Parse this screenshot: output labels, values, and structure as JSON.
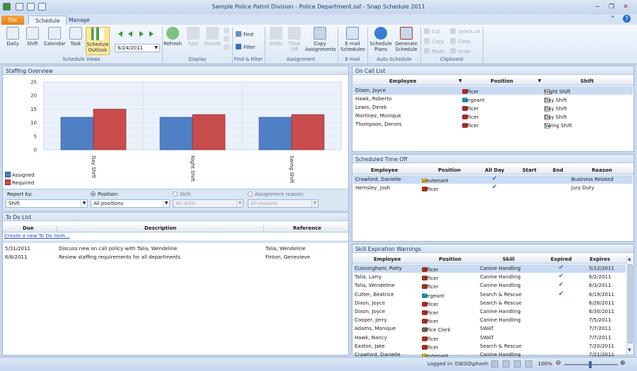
{
  "window": {
    "title": "Sample Police Patrol Division - Police Department.ssf - Snap Schedule 2011",
    "minimize": "−",
    "restore": "❐",
    "close": "✕"
  },
  "tabs": {
    "file": "File",
    "schedule": "Schedule",
    "manage": "Manage"
  },
  "ribbon": {
    "daily": "Daily",
    "shift": "Shift",
    "calendar": "Calendar",
    "task": "Task",
    "schedule_outlook": "Schedule Outlook",
    "date": "6/24/2011",
    "schedule_views": "Schedule Views",
    "refresh": "Refresh",
    "sort": "Sort",
    "details": "Details",
    "display": "Display",
    "find": "Find",
    "filter": "Filter",
    "find_filter": "Find & Filter",
    "shifts": "Shifts",
    "time_off": "Time Off",
    "copy_assignments": "Copy Assignments",
    "assignment": "Assignment",
    "email_schedules": "E-mail Schedules",
    "email": "E-mail",
    "schedule_plans": "Schedule Plans",
    "generate_schedule": "Generate Schedule",
    "auto_schedule": "Auto Schedule",
    "cut": "Cut",
    "copy": "Copy",
    "paste": "Paste",
    "select_all": "Select all",
    "clear": "Clear",
    "undo": "Undo",
    "clipboard": "Clipboard"
  },
  "staffing": {
    "title": "Staffing Overview",
    "report_by_label": "Report by:",
    "report_by_value": "Shift",
    "position_label": "Position:",
    "position_value": "All positions",
    "skill_label": "Skill:",
    "skill_value": "All skills",
    "reason_label": "Assignment reason:",
    "reason_value": "All reasons"
  },
  "chart_data": {
    "type": "bar",
    "categories": [
      "Day Shift",
      "Night Shift",
      "Swing Shift"
    ],
    "series": [
      {
        "name": "Assigned",
        "values": [
          12,
          12,
          12
        ],
        "color": "#4f7fc4"
      },
      {
        "name": "Required",
        "values": [
          15,
          13,
          13
        ],
        "color": "#c94c4c"
      }
    ],
    "yticks": [
      "25",
      "20",
      "15",
      "10",
      "5",
      "0"
    ],
    "ylim": [
      0,
      25
    ],
    "legend": "bottom-left"
  },
  "todo": {
    "title": "To Do List",
    "headers": {
      "due": "Due",
      "description": "Description",
      "reference": "Reference"
    },
    "create_link": "Create a new To Do item...",
    "rows": [
      {
        "due": "5/31/2011",
        "description": "Discuss new on call policy with Talia, Wendeline",
        "reference": "Talia, Wendeline"
      },
      {
        "due": "6/8/2011",
        "description": "Review staffing requirements for all departments",
        "reference": "Finton, Genevieve"
      }
    ]
  },
  "oncall": {
    "title": "On Call List",
    "headers": {
      "employee": "Employee",
      "position": "Position",
      "shift": "Shift"
    },
    "rows": [
      {
        "employee": "Dixon, Joyce",
        "position": "Officer",
        "pos_color": "#d43a2a",
        "shift": "Night Shift",
        "shift_color": "#f3f3f3"
      },
      {
        "employee": "Hawk, Roberto",
        "position": "Sergeant",
        "pos_color": "#2fb9c9",
        "shift": "Day Shift",
        "shift_color": "#f6dbe6"
      },
      {
        "employee": "Lewis, Derek",
        "position": "Officer",
        "pos_color": "#d43a2a",
        "shift": "Day Shift",
        "shift_color": "#f6dbe6"
      },
      {
        "employee": "Martinez, Monique",
        "position": "Officer",
        "pos_color": "#d43a2a",
        "shift": "Day Shift",
        "shift_color": "#f6dbe6"
      },
      {
        "employee": "Thompson, Dennis",
        "position": "Officer",
        "pos_color": "#d43a2a",
        "shift": "Swing Shift",
        "shift_color": "#d6f0f4"
      }
    ]
  },
  "timeoff": {
    "title": "Scheduled Time Off",
    "headers": {
      "employee": "Employee",
      "position": "Position",
      "allday": "All Day",
      "start": "Start",
      "end": "End",
      "reason": "Reason"
    },
    "rows": [
      {
        "employee": "Crawford, Danielle",
        "position": "Lieutenant",
        "pos_color": "#e9c43a",
        "allday": "✔",
        "reason": "Business Related"
      },
      {
        "employee": "Hemsley, Josh",
        "position": "Officer",
        "pos_color": "#d43a2a",
        "allday": "✔",
        "reason": "Jury Duty"
      }
    ]
  },
  "skills": {
    "title": "Skill Expiration Warnings",
    "headers": {
      "employee": "Employee",
      "position": "Position",
      "skill": "Skill",
      "expired": "Expired",
      "expires": "Expires"
    },
    "rows": [
      {
        "employee": "Cunningham, Patty",
        "position": "Officer",
        "pos_color": "#d43a2a",
        "skill": "Canine Handling",
        "expired": "✔",
        "expires": "5/12/2011"
      },
      {
        "employee": "Talia, Larry",
        "position": "Officer",
        "pos_color": "#d43a2a",
        "skill": "Canine Handling",
        "expired": "✔",
        "expires": "6/2/2011"
      },
      {
        "employee": "Talia, Wendeline",
        "position": "Officer",
        "pos_color": "#d43a2a",
        "skill": "Canine Handling",
        "expired": "✔",
        "expires": "6/3/2011"
      },
      {
        "employee": "Cutter, Beatrice",
        "position": "Sergeant",
        "pos_color": "#2fb9c9",
        "skill": "Search & Rescue",
        "expired": "✔",
        "expires": "6/19/2011"
      },
      {
        "employee": "Dixon, Joyce",
        "position": "Officer",
        "pos_color": "#d43a2a",
        "skill": "Search & Rescue",
        "expired": "",
        "expires": "6/26/2011"
      },
      {
        "employee": "Dixon, Joyce",
        "position": "Officer",
        "pos_color": "#d43a2a",
        "skill": "Canine Handling",
        "expired": "",
        "expires": "6/30/2011"
      },
      {
        "employee": "Cooper, Jerry",
        "position": "Officer",
        "pos_color": "#d43a2a",
        "skill": "Canine Handling",
        "expired": "",
        "expires": "7/5/2011"
      },
      {
        "employee": "Adams, Monique",
        "position": "Office Clerk",
        "pos_color": "#8a7a6a",
        "skill": "SWAT",
        "expired": "",
        "expires": "7/7/2011"
      },
      {
        "employee": "Hawk, Nancy",
        "position": "Officer",
        "pos_color": "#d43a2a",
        "skill": "SWAT",
        "expired": "",
        "expires": "7/7/2011"
      },
      {
        "employee": "Easton, Jake",
        "position": "Officer",
        "pos_color": "#d43a2a",
        "skill": "Search & Rescue",
        "expired": "",
        "expires": "7/20/2011"
      },
      {
        "employee": "Crawford, Danielle",
        "position": "Lieutenant",
        "pos_color": "#e9c43a",
        "skill": "Canine Handling",
        "expired": "",
        "expires": "7/21/2011"
      }
    ]
  },
  "status": {
    "logged_in": "Logged in: DIEGO\\phanh",
    "zoom": "100%"
  }
}
